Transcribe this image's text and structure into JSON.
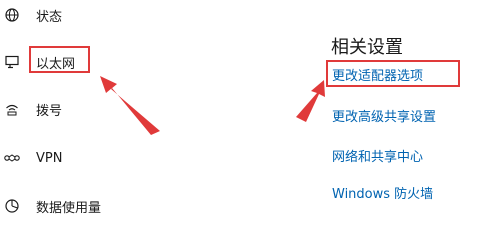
{
  "sidebar": {
    "items": [
      {
        "label": "状态",
        "icon": "globe-icon"
      },
      {
        "label": "以太网",
        "icon": "ethernet-monitor-icon"
      },
      {
        "label": "拨号",
        "icon": "dialup-signal-icon"
      },
      {
        "label": "VPN",
        "icon": "vpn-icon"
      },
      {
        "label": "数据使用量",
        "icon": "data-usage-pie-icon"
      }
    ]
  },
  "related": {
    "title": "相关设置",
    "links": [
      {
        "label": "更改适配器选项"
      },
      {
        "label": "更改高级共享设置"
      },
      {
        "label": "网络和共享中心"
      },
      {
        "label": "Windows 防火墙"
      }
    ]
  },
  "annotations": {
    "highlight_color": "#e03a3a",
    "arrow_color": "#e03a3a",
    "link_color": "#0063b1"
  }
}
